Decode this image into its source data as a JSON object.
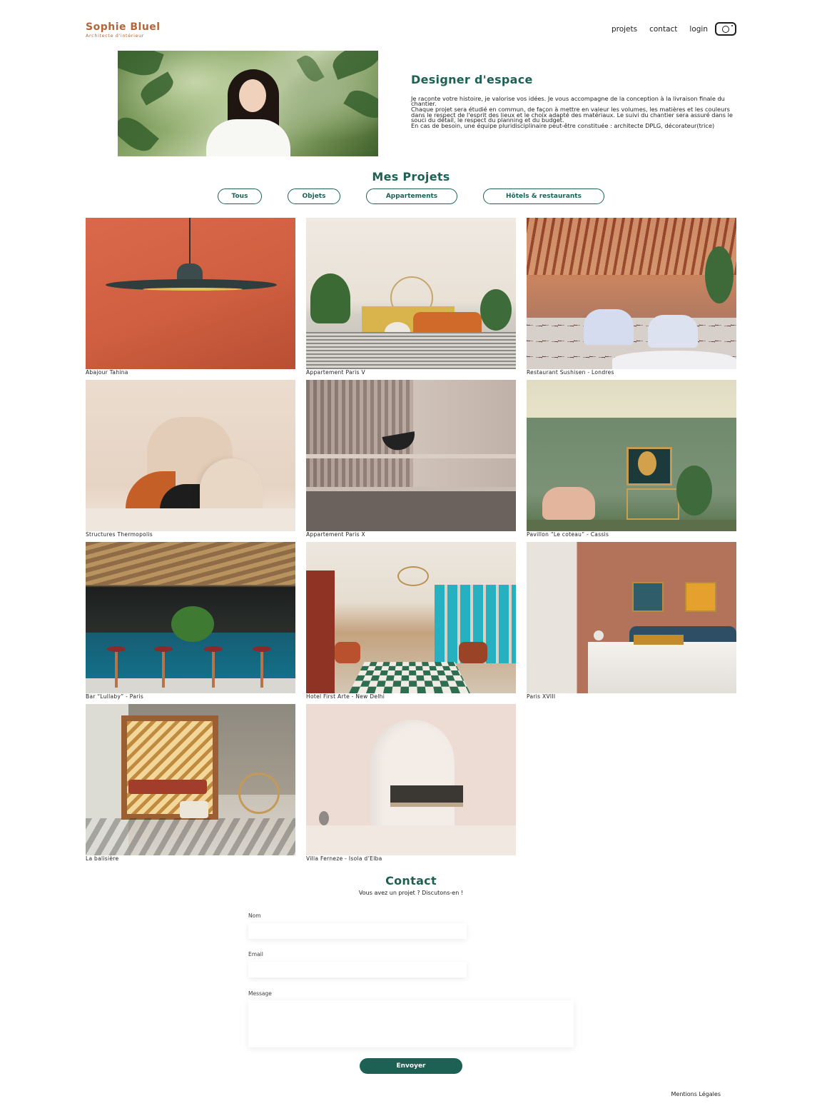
{
  "header": {
    "logo_title": "Sophie Bluel",
    "logo_subtitle": "Architecte d'intérieur",
    "nav": [
      "projets",
      "contact",
      "login"
    ],
    "instagram_icon": "instagram-icon"
  },
  "intro": {
    "title": "Designer d'espace",
    "paragraphs": [
      "Je raconte votre histoire, je valorise vos idées. Je vous accompagne de la conception à la livraison finale du chantier.",
      "Chaque projet sera étudié en commun, de façon à mettre en valeur les volumes, les matières et les couleurs dans le respect de l'esprit des lieux et le choix adapté des matériaux. Le suivi du chantier sera assuré dans le souci du détail, le respect du planning et du budget.",
      "En cas de besoin, une équipe pluridisciplinaire peut-être constituée : architecte DPLG, décorateur(trice)"
    ]
  },
  "projects": {
    "title": "Mes Projets",
    "filters": [
      "Tous",
      "Objets",
      "Appartements",
      "Hôtels & restaurants"
    ],
    "items": [
      "Abajour Tahina",
      "Appartement Paris V",
      "Restaurant Sushisen - Londres",
      "Structures Thermopolis",
      "Appartement Paris X",
      "Pavillon “Le coteau” - Cassis",
      "Bar “Lullaby” - Paris",
      "Hotel First Arte - New Delhi",
      "Paris XVIII",
      "La balisière",
      "Villa Ferneze - Isola d’Elba"
    ]
  },
  "contact": {
    "title": "Contact",
    "subtitle": "Vous avez un projet ? Discutons-en !",
    "name_label": "Nom",
    "email_label": "Email",
    "message_label": "Message",
    "submit_label": "Envoyer"
  },
  "footer": {
    "legal": "Mentions Légales"
  },
  "colors": {
    "accent": "#1d6154",
    "brand": "#b1663c"
  }
}
